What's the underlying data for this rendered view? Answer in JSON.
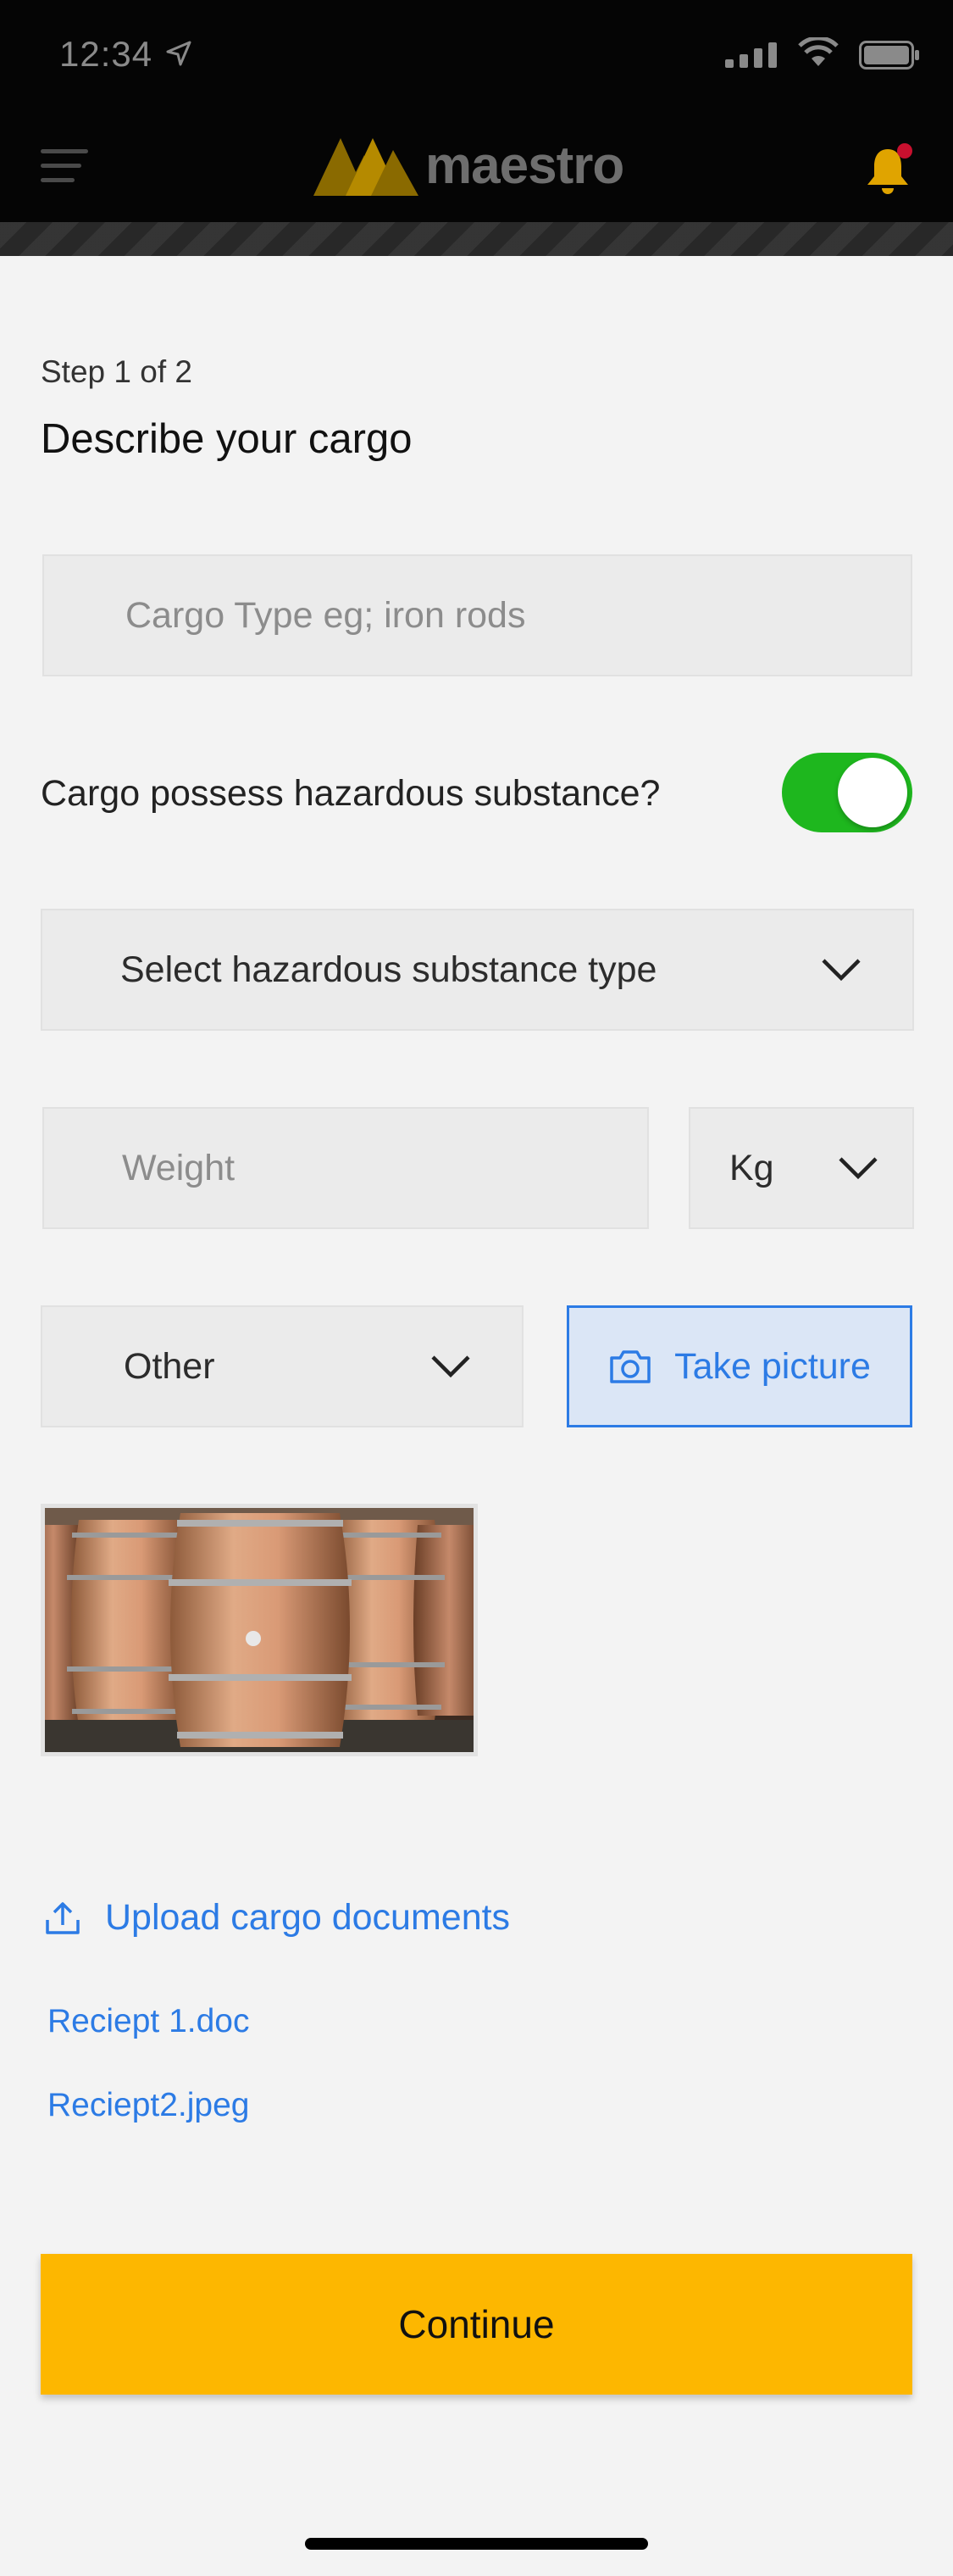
{
  "status_bar": {
    "time": "12:34"
  },
  "header": {
    "logo_text": "maestro",
    "brand_color": "#E8A800"
  },
  "step": "Step 1 of 2",
  "title": "Describe your cargo",
  "cargo_type": {
    "value": "",
    "placeholder": "Cargo Type eg; iron rods"
  },
  "hazard": {
    "question": "Cargo possess hazardous substance?",
    "enabled": true,
    "toggle_color": "#1EB71E"
  },
  "hazard_type": {
    "placeholder": "Select hazardous substance type"
  },
  "weight": {
    "value": "",
    "placeholder": "Weight",
    "unit": "Kg"
  },
  "category": {
    "value": "Other"
  },
  "take_picture_label": "Take picture",
  "upload_label": "Upload cargo documents",
  "documents": [
    "Reciept 1.doc",
    "Reciept2.jpeg"
  ],
  "continue_label": "Continue",
  "accent_color": "#2C7BE5",
  "button_color": "#FDB700"
}
